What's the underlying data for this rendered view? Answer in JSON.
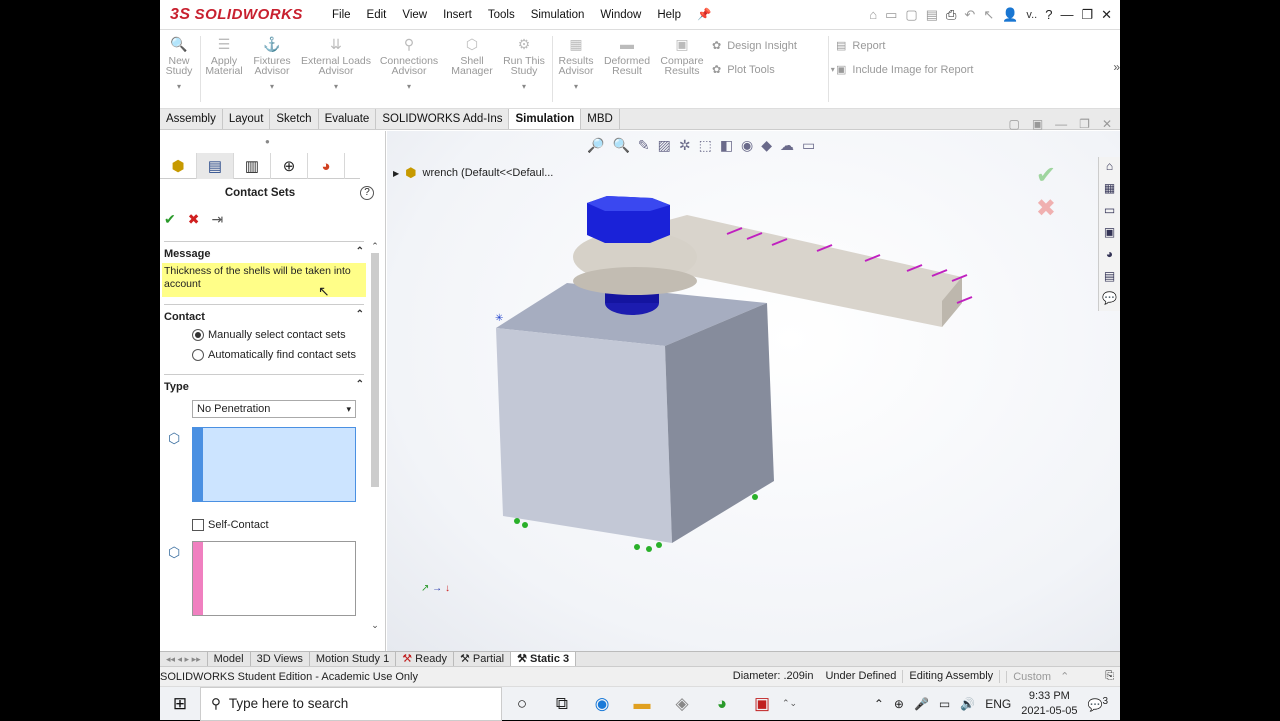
{
  "app": {
    "logo": "SOLIDWORKS",
    "logo_mark": "3S"
  },
  "menu": [
    "File",
    "Edit",
    "View",
    "Insert",
    "Tools",
    "Simulation",
    "Window",
    "Help"
  ],
  "quick": {
    "user_label": "v.."
  },
  "commands": {
    "new_study": "New Study",
    "apply_material": "Apply Material",
    "fixtures": "Fixtures Advisor",
    "loads": "External Loads Advisor",
    "connections": "Connections Advisor",
    "shell": "Shell Manager",
    "run": "Run This Study",
    "results": "Results Advisor",
    "deformed": "Deformed Result",
    "compare": "Compare Results",
    "design_insight": "Design Insight",
    "plot_tools": "Plot Tools",
    "report": "Report",
    "include_image": "Include Image for Report"
  },
  "tabs": [
    "Assembly",
    "Layout",
    "Sketch",
    "Evaluate",
    "SOLIDWORKS Add-Ins",
    "Simulation",
    "MBD"
  ],
  "active_tab": "Simulation",
  "panel": {
    "title": "Contact Sets",
    "message_header": "Message",
    "message": "Thickness of the shells will be taken into account",
    "contact_header": "Contact",
    "contact_options": [
      "Manually select contact sets",
      "Automatically find contact sets"
    ],
    "type_header": "Type",
    "type_value": "No Penetration",
    "self_contact": "Self-Contact"
  },
  "graphics": {
    "tree_label": "wrench  (Default<<Defaul..."
  },
  "bottom_tabs": [
    "Model",
    "3D Views",
    "Motion Study 1",
    "Ready",
    "Partial",
    "Static 3"
  ],
  "status": {
    "edition": "SOLIDWORKS Student Edition - Academic Use Only",
    "diameter": "Diameter: .209in",
    "defined": "Under Defined",
    "editing": "Editing Assembly",
    "units": "Custom"
  },
  "taskbar": {
    "search_placeholder": "Type here to search",
    "lang": "ENG",
    "time": "9:33 PM",
    "date": "2021-05-05",
    "notif_count": "3"
  },
  "colors": {
    "accent": "#c8202f",
    "message_bg": "#fffe88",
    "selbox1": "#cce4ff",
    "selbox2_bar": "#f080c0"
  }
}
